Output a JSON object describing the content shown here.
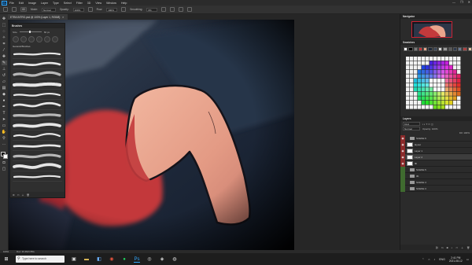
{
  "app": {
    "logo": "Ps",
    "menu": [
      "File",
      "Edit",
      "Image",
      "Layer",
      "Type",
      "Select",
      "Filter",
      "3D",
      "View",
      "Window",
      "Help"
    ],
    "window_controls": [
      "—",
      "❐",
      "✕"
    ]
  },
  "options": {
    "brush_size": "60",
    "mode_label": "Mode:",
    "mode_value": "Normal",
    "opacity_label": "Opacity:",
    "opacity_value": "100%",
    "flow_label": "Flow:",
    "flow_value": "100%",
    "smoothing_label": "Smoothing:",
    "smoothing_value": "0%"
  },
  "document": {
    "tab_title": "ETRA INTRO.psd @ 100% (Layer 1, RGB/8)",
    "close_glyph": "×"
  },
  "brushes_panel": {
    "title": "Brushes",
    "size_label": "Size",
    "size_value": "60 px",
    "group_label": "General Brushes",
    "strokes": 13
  },
  "panels": {
    "navigator_title": "Navigator",
    "swatches_title": "Swatches",
    "layers_title": "Layers",
    "layers_kind": "Kind",
    "layers_blend": "Normal",
    "layers_opacity": "Opacity: 100%",
    "layers_fill": "Fill: 100%"
  },
  "layers": [
    {
      "name": "SCENE 6",
      "type": "group",
      "eye": true,
      "color": "#8a2a2a",
      "active": false
    },
    {
      "name": "layout",
      "type": "layer",
      "eye": true,
      "color": "#8a2a2a",
      "active": false
    },
    {
      "name": "Layer 1",
      "type": "layer",
      "eye": true,
      "color": "#8a2a2a",
      "active": false
    },
    {
      "name": "Layer 2",
      "type": "layer",
      "eye": true,
      "color": "#8a2a2a",
      "active": true
    },
    {
      "name": "fill",
      "type": "layer",
      "eye": true,
      "color": "#8a2a2a",
      "active": false
    },
    {
      "name": "SCENE 5",
      "type": "group",
      "eye": false,
      "color": "#3f6b2f",
      "active": false
    },
    {
      "name": "3b",
      "type": "group",
      "eye": false,
      "color": "#3f6b2f",
      "active": false
    },
    {
      "name": "SCENE 4",
      "type": "group",
      "eye": false,
      "color": "#3f6b2f",
      "active": false
    },
    {
      "name": "SCENE 3",
      "type": "group",
      "eye": false,
      "color": "#3f6b2f",
      "active": false
    }
  ],
  "status": {
    "zoom": "100%",
    "doc_info": "Doc: 26.4M/1.55G"
  },
  "taskbar": {
    "search_placeholder": "Type here to search",
    "language": "ENG",
    "time": "2:41 PM",
    "date": "2021-08-12"
  },
  "colors": {
    "accent": "#31a8ff",
    "panel_bg": "#2b2b2b",
    "canvas_navy": "#1e2838",
    "cloth_red": "#c0363a",
    "skin": "#e7a58a"
  }
}
